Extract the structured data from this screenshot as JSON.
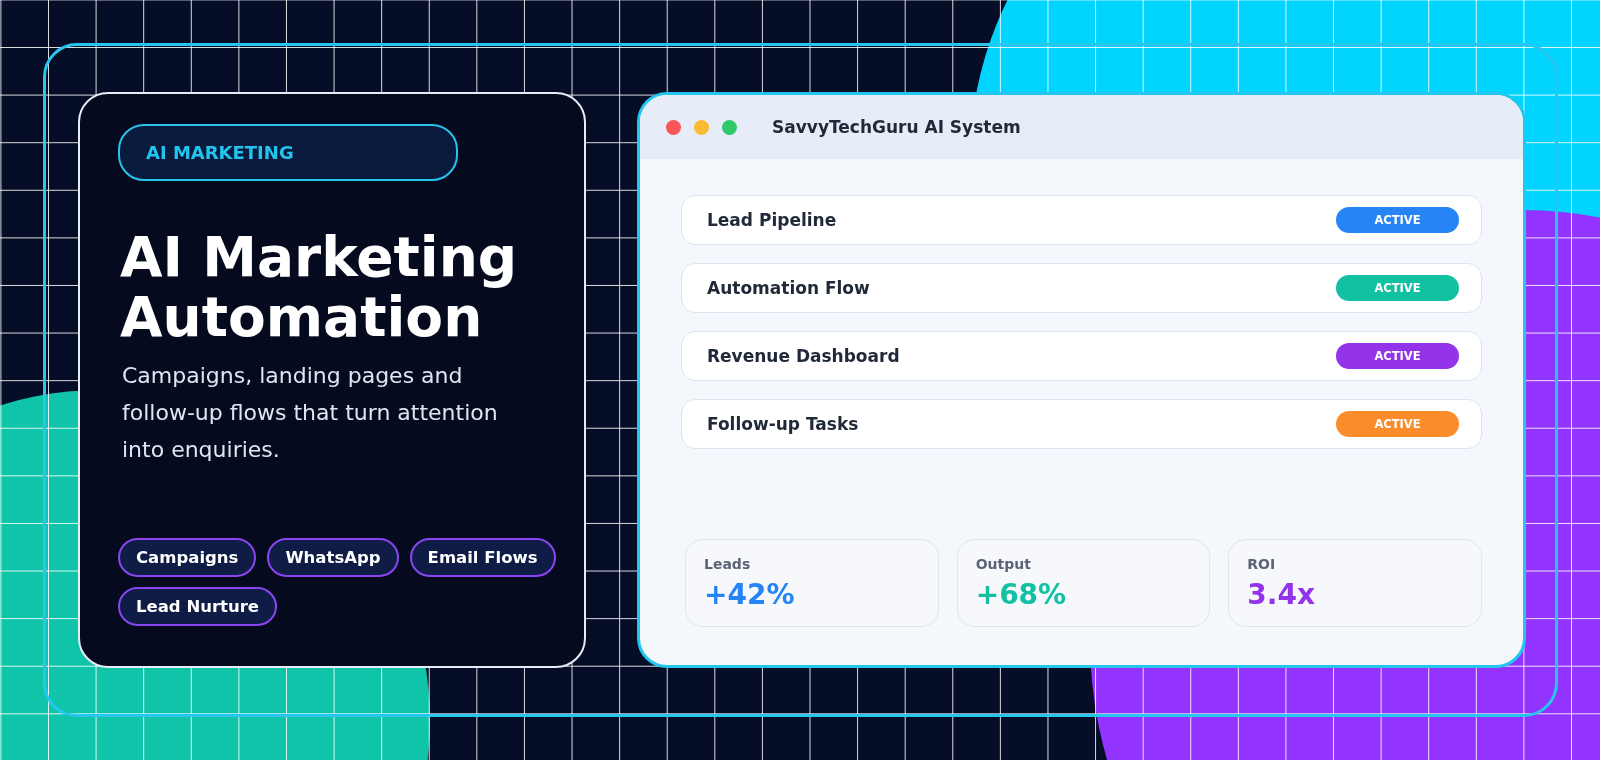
{
  "hero": {
    "badge": "AI MARKETING",
    "title": "AI Marketing Automation",
    "subtitle": "Campaigns, landing pages and follow-up flows that turn attention into enquiries.",
    "tags": [
      "Campaigns",
      "WhatsApp",
      "Email Flows",
      "Lead Nurture"
    ]
  },
  "window": {
    "title": "SavvyTechGuru AI System",
    "rows": [
      {
        "label": "Lead Pipeline",
        "status": "ACTIVE",
        "color": "#2684f5"
      },
      {
        "label": "Automation Flow",
        "status": "ACTIVE",
        "color": "#12c0a2"
      },
      {
        "label": "Revenue Dashboard",
        "status": "ACTIVE",
        "color": "#9333ea"
      },
      {
        "label": "Follow-up Tasks",
        "status": "ACTIVE",
        "color": "#fb8c2c"
      }
    ],
    "stats": [
      {
        "label": "Leads",
        "value": "+42%",
        "color": "#2684f5"
      },
      {
        "label": "Output",
        "value": "+68%",
        "color": "#12c0a2"
      },
      {
        "label": "ROI",
        "value": "3.4x",
        "color": "#9333ea"
      }
    ]
  }
}
